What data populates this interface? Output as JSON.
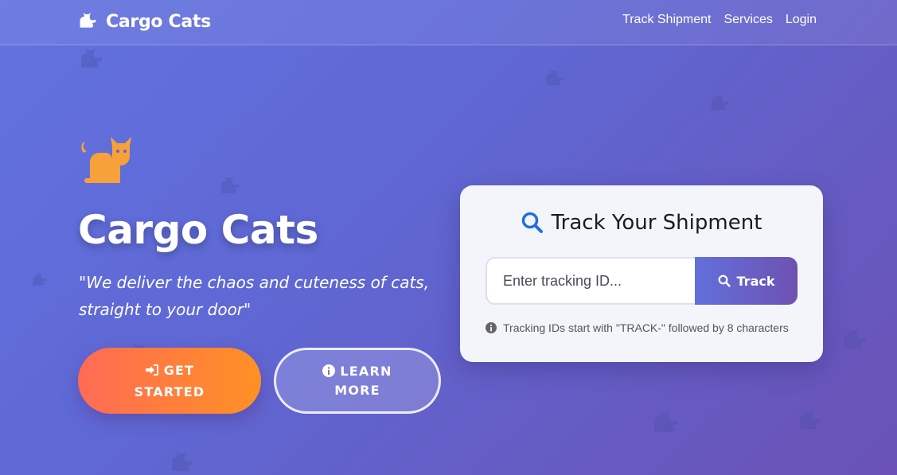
{
  "nav": {
    "brand": "Cargo Cats",
    "brand_icon": "cat-icon",
    "links": [
      "Track Shipment",
      "Services",
      "Login"
    ]
  },
  "hero": {
    "icon": "cat-icon",
    "title": "Cargo Cats",
    "tagline": "\"We deliver the chaos and cuteness of cats, straight to your door\"",
    "primary_button": {
      "line1": "GET",
      "line2": "STARTED",
      "icon": "sign-in-icon"
    },
    "secondary_button": {
      "line1": "LEARN",
      "line2": "MORE",
      "icon": "info-circle-icon"
    }
  },
  "tracking": {
    "title": "Track Your Shipment",
    "title_icon": "search-icon",
    "input_placeholder": "Enter tracking ID...",
    "input_value": "",
    "button_label": "Track",
    "hint": "Tracking IDs start with \"TRACK-\" followed by 8 characters",
    "hint_icon": "info-circle-icon"
  },
  "colors": {
    "accent_orange": "#ff9124",
    "cat_orange": "#f7a13a",
    "search_blue": "#1f6fe0",
    "gradient_start": "#6272e0",
    "gradient_end": "#6a52b6"
  }
}
